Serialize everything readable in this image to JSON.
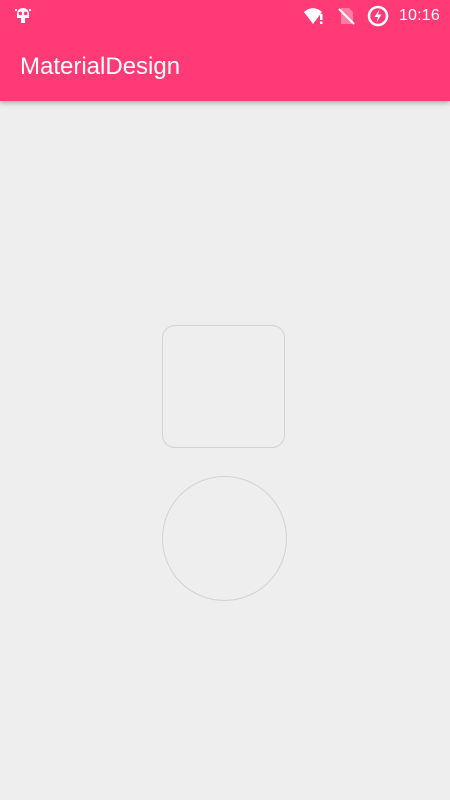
{
  "statusbar": {
    "time": "10:16",
    "icons": [
      "android-debug-icon",
      "wifi-alert-icon",
      "no-sim-icon",
      "battery-charging-icon"
    ]
  },
  "appbar": {
    "title": "MaterialDesign",
    "background_color": "#ff3a76"
  },
  "content": {
    "background_color": "#eeeeee",
    "shapes": [
      "rounded-square",
      "circle"
    ]
  }
}
